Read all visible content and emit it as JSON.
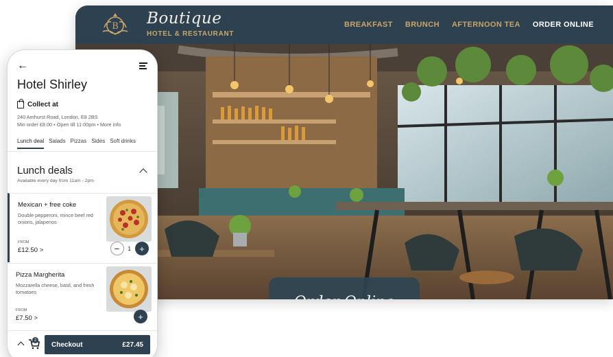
{
  "brand": {
    "emblem_letter": "B",
    "name": "Boutique",
    "subtitle": "HOTEL & RESTAURANT"
  },
  "nav": {
    "items": [
      {
        "label": "BREAKFAST"
      },
      {
        "label": "BRUNCH"
      },
      {
        "label": "AFTERNOON TEA"
      },
      {
        "label": "ORDER ONLINE"
      }
    ]
  },
  "hero": {
    "cta_label": "Order Online"
  },
  "mobile": {
    "title": "Hotel Shirley",
    "collect_label": "Collect at",
    "address": "240 Amhurst Road, London, E8 2BS",
    "info": "Min order £8.00 • Open till 11:00pm • More info",
    "tabs": [
      {
        "label": "Lunch deal"
      },
      {
        "label": "Salads"
      },
      {
        "label": "Pizzas"
      },
      {
        "label": "Sides"
      },
      {
        "label": "Soft drinks"
      }
    ],
    "section": {
      "title": "Lunch deals",
      "subtitle": "Available every day from 11am - 2pm"
    },
    "items": [
      {
        "name": "Mexican + free coke",
        "description": "Double pepperoni, mince beef red onions, jalapenos",
        "from_label": "FROM",
        "price": "£12.50 >",
        "quantity": "1"
      },
      {
        "name": "Pizza Margherita",
        "description": "Mozzarella cheese, basil, and fresh tomatoes",
        "from_label": "FROM",
        "price": "£7.50 >"
      }
    ],
    "cart_count": "2",
    "checkout_label": "Checkout",
    "checkout_total": "£27.45"
  },
  "colors": {
    "navy": "#2e4150",
    "gold": "#c9a46a",
    "white": "#ffffff"
  }
}
